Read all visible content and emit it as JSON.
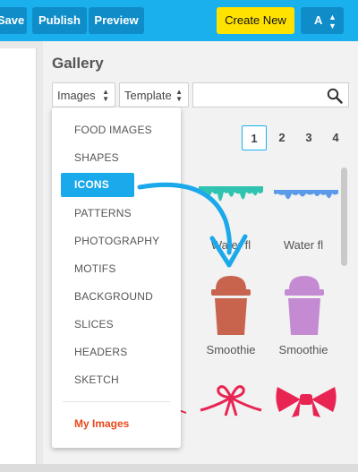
{
  "toolbar": {
    "save_label": "Save",
    "publish_label": "Publish",
    "preview_label": "Preview",
    "create_new_label": "Create New",
    "account_label": "A"
  },
  "gallery": {
    "title": "Gallery",
    "type_select": "Images",
    "template_select": "Template",
    "search_placeholder": "",
    "pages": [
      "1",
      "2",
      "3",
      "4"
    ],
    "active_page": "1",
    "captions": [
      "Water fl",
      "Water fl",
      "Smoothie",
      "Smoothie"
    ]
  },
  "dropdown": {
    "items": [
      "FOOD IMAGES",
      "SHAPES",
      "ICONS",
      "PATTERNS",
      "PHOTOGRAPHY",
      "MOTIFS",
      "BACKGROUND",
      "SLICES",
      "HEADERS",
      "SKETCH"
    ],
    "selected": "ICONS",
    "my_images": "My Images"
  },
  "colors": {
    "top_bar": "#1ab0ee",
    "create_button": "#ffe200",
    "selected_item": "#1aa9ea",
    "my_images": "#e8481c",
    "arrow": "#1aa9ea"
  }
}
